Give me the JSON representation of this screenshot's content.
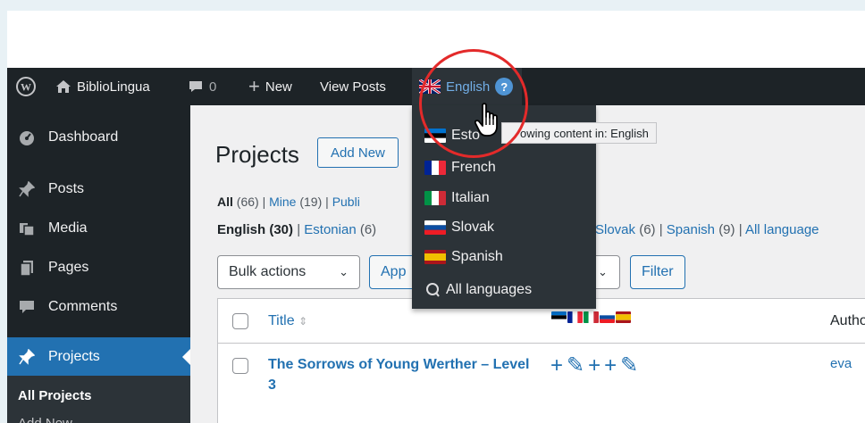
{
  "adminbar": {
    "wp_logo": "wordpress-logo-icon",
    "site_name": "BiblioLingua",
    "comments_count": "0",
    "new_label": "New",
    "view_posts_label": "View Posts",
    "current_language": "English",
    "help_label": "?"
  },
  "sidebar": {
    "items": [
      {
        "label": "Dashboard",
        "icon": "dashboard-icon"
      },
      {
        "label": "Posts",
        "icon": "pushpin-icon"
      },
      {
        "label": "Media",
        "icon": "media-icon"
      },
      {
        "label": "Pages",
        "icon": "pages-icon"
      },
      {
        "label": "Comments",
        "icon": "comment-icon"
      },
      {
        "label": "Projects",
        "icon": "pushpin-icon"
      }
    ],
    "submenu": [
      "All Projects",
      "Add New"
    ]
  },
  "page": {
    "title": "Projects",
    "add_new": "Add New",
    "views": {
      "all": "All",
      "all_count": "(66)",
      "mine": "Mine",
      "mine_count": "(19)",
      "published": "Publi"
    },
    "lang_filter": {
      "english": "English",
      "english_count": "(30)",
      "estonian": "Estonian",
      "estonian_count": "(6)",
      "slovak": "Slovak",
      "slovak_count": "(6)",
      "spanish": "Spanish",
      "spanish_count": "(9)",
      "all": "All language"
    },
    "bulk_actions": "Bulk actions",
    "apply": "App",
    "filter": "Filter"
  },
  "table": {
    "columns": {
      "title": "Title",
      "author": "Autho"
    },
    "rows": [
      {
        "title": "The Sorrows of Young Werther – Level 3",
        "actions": "+✎++✎",
        "author": "eva"
      }
    ]
  },
  "language_dropdown": {
    "items": [
      {
        "label": "Esto",
        "flag": "ee"
      },
      {
        "label": "French",
        "flag": "fr"
      },
      {
        "label": "Italian",
        "flag": "it"
      },
      {
        "label": "Slovak",
        "flag": "sk"
      },
      {
        "label": "Spanish",
        "flag": "es"
      }
    ],
    "all_languages": "All languages"
  },
  "tooltip": "owing content in: English",
  "colors": {
    "adminbar": "#1d2327",
    "accent": "#2271b1",
    "link_hover": "#72aee6",
    "highlight_circle": "#e32a2a"
  }
}
